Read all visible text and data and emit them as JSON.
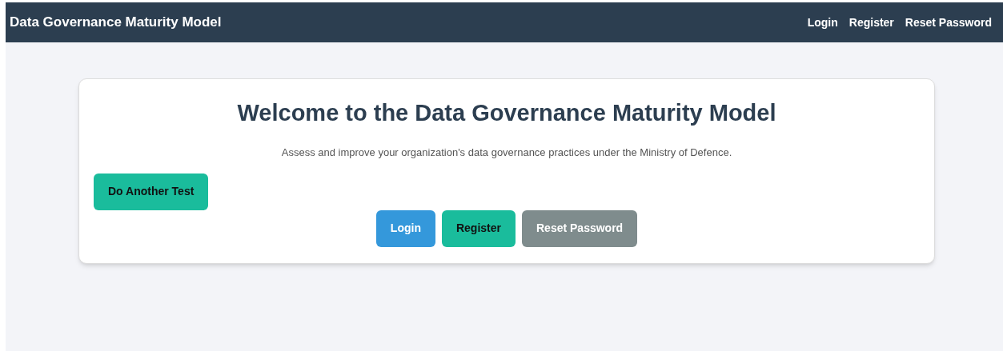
{
  "navbar": {
    "title": "Data Governance Maturity Model",
    "links": [
      "Login",
      "Register",
      "Reset Password"
    ]
  },
  "card": {
    "title": "Welcome to the Data Governance Maturity Model",
    "description": "Assess and improve your organization's data governance practices under the Ministry of Defence.",
    "retest_button": {
      "label": "Do Another Test",
      "kind": "success"
    },
    "buttons": [
      {
        "label": "Login",
        "kind": "primary"
      },
      {
        "label": "Register",
        "kind": "success"
      },
      {
        "label": "Reset Password",
        "kind": "secondary"
      }
    ]
  }
}
